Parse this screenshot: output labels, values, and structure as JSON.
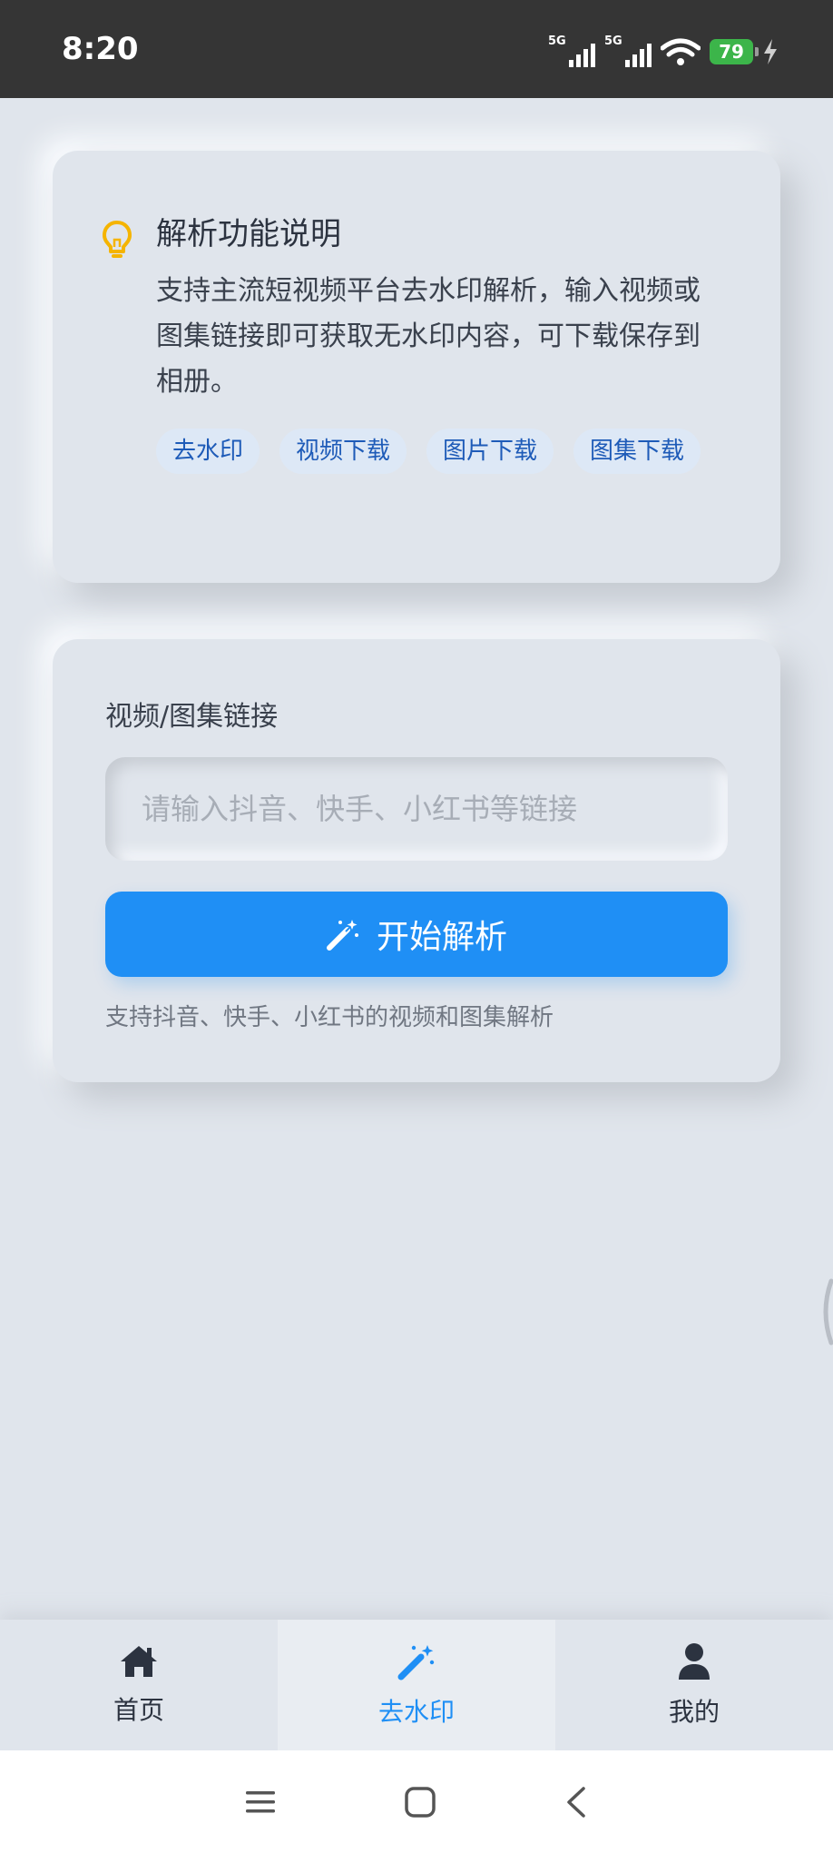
{
  "status_bar": {
    "time": "8:20",
    "signal_1_label": "5G",
    "signal_2_label": "5G",
    "battery_level": "79"
  },
  "info_card": {
    "title": "解析功能说明",
    "description": "支持主流短视频平台去水印解析，输入视频或图集链接即可获取无水印内容，可下载保存到相册。",
    "tags": [
      "去水印",
      "视频下载",
      "图片下载",
      "图集下载"
    ],
    "icon": "lightbulb-icon",
    "icon_color": "#f5b400"
  },
  "form_card": {
    "label": "视频/图集链接",
    "input_value": "",
    "input_placeholder": "请输入抖音、快手、小红书等链接",
    "submit_label": "开始解析",
    "submit_icon": "magic-wand-icon",
    "hint": "支持抖音、快手、小红书的视频和图集解析",
    "accent_color": "#1f8ff5"
  },
  "tabbar": {
    "items": [
      {
        "label": "首页",
        "icon": "home-icon",
        "active": false
      },
      {
        "label": "去水印",
        "icon": "magic-wand-icon",
        "active": true
      },
      {
        "label": "我的",
        "icon": "user-icon",
        "active": false
      }
    ]
  },
  "system_nav": {
    "items": [
      "menu-icon",
      "home-square-icon",
      "back-icon"
    ]
  }
}
